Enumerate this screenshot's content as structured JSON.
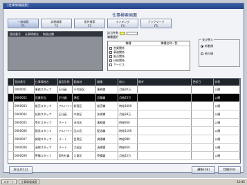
{
  "window": {
    "title": "【仕事情報検索】"
  },
  "header": {
    "title": "仕事検索画面"
  },
  "tabs": [
    {
      "label": "一般検索",
      "num": "F1"
    },
    {
      "label": "詳細検索",
      "num": "F2"
    },
    {
      "label": "条件検索",
      "num": "F3"
    },
    {
      "label": "ランキング",
      "num": "F4"
    },
    {
      "label": "ブックマーク",
      "num": "F5"
    }
  ],
  "left_panel": {
    "headers": [
      "登録番号",
      "仕事情報名",
      "取扱店舗"
    ]
  },
  "mid_panel": {
    "field_label": "該当件数",
    "field_value": "",
    "category_label": "職種選択",
    "list_header": [
      "職種",
      "職種名称一覧"
    ],
    "items": [
      "営業関係",
      "事務関係",
      "販売関係",
      "技術関係",
      "サービス"
    ]
  },
  "right_panel": {
    "legend": "並び替え",
    "options": [
      "新着順",
      "給与順"
    ],
    "selected": 0
  },
  "grid": {
    "headers": [
      "",
      "登録番号",
      "仕事情報名",
      "雇用形態",
      "勤務地",
      "職種",
      "給与",
      "備考",
      "更新日",
      "状態"
    ],
    "rows": [
      [
        "",
        "0000001",
        "事務スタッフ",
        "正社員",
        "千代田区",
        "事務職",
        "月給20万",
        "",
        "",
        "公開"
      ],
      [
        "",
        "0000002",
        "営業担当",
        "正社員",
        "港区",
        "営業職",
        "月給25万",
        "",
        "",
        "公開"
      ],
      [
        "",
        "0000003",
        "販売スタッフ",
        "アルバイト",
        "新宿区",
        "販売職",
        "時給1000",
        "",
        "",
        "公開"
      ],
      [
        "",
        "0000004",
        "技術スタッフ",
        "正社員",
        "中央区",
        "技術職",
        "月給28万",
        "",
        "",
        "公開"
      ],
      [
        "",
        "0000005",
        "受付スタッフ",
        "パート",
        "渋谷区",
        "事務職",
        "時給950",
        "",
        "",
        "公開"
      ],
      [
        "",
        "0000006",
        "配送スタッフ",
        "アルバイト",
        "品川区",
        "配送職",
        "時給1100",
        "",
        "",
        "公開"
      ],
      [
        "",
        "0000007",
        "調理スタッフ",
        "パート",
        "目黒区",
        "調理職",
        "時給980",
        "",
        "",
        "公開"
      ],
      [
        "",
        "0000008",
        "清掃スタッフ",
        "パート",
        "大田区",
        "清掃職",
        "時給950",
        "",
        "",
        "公開"
      ],
      [
        "",
        "0000009",
        "警備スタッフ",
        "契約社員",
        "江東区",
        "警備職",
        "月給22万",
        "",
        "",
        "公開"
      ]
    ],
    "selected_row": 1
  },
  "buttons": {
    "back": "戻る(F12)",
    "select": "選択(F8)",
    "print": "印刷(F9)"
  },
  "taskbar": {
    "start": "スタート",
    "app": "仕事情報検索",
    "clock": "10:45"
  }
}
